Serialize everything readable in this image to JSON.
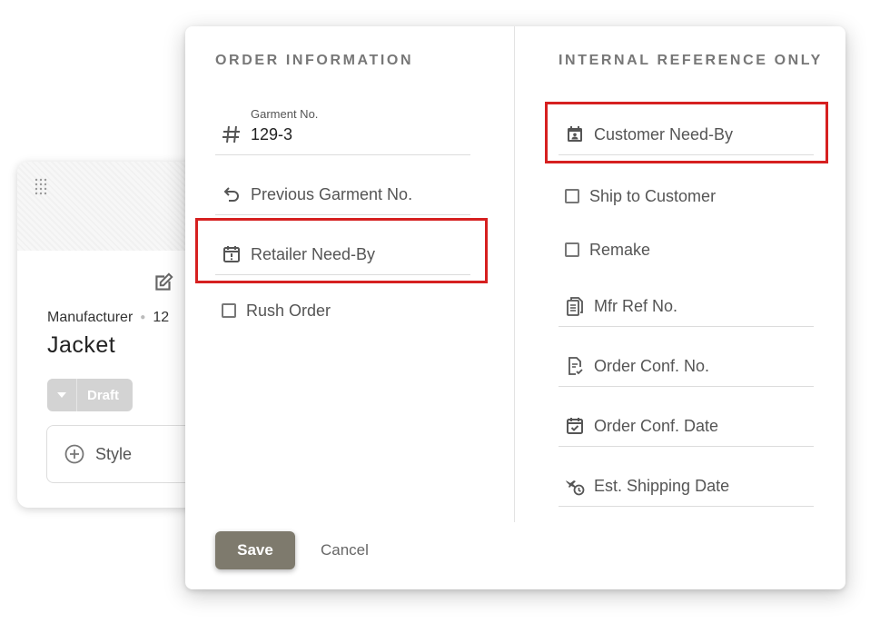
{
  "card": {
    "manufacturer_label": "Manufacturer",
    "manufacturer_value": "12",
    "title": "Jacket",
    "status": "Draft",
    "style_label": "Style"
  },
  "dialog": {
    "left": {
      "section_title": "ORDER INFORMATION",
      "garment_no_label": "Garment No.",
      "garment_no_value": "129-3",
      "previous_garment_label": "Previous Garment No.",
      "retailer_need_by_label": "Retailer Need-By",
      "rush_order_label": "Rush Order"
    },
    "right": {
      "section_title": "INTERNAL REFERENCE ONLY",
      "customer_need_by_label": "Customer Need-By",
      "ship_to_customer_label": "Ship to Customer",
      "remake_label": "Remake",
      "mfr_ref_label": "Mfr Ref No.",
      "order_conf_no_label": "Order Conf. No.",
      "order_conf_date_label": "Order Conf. Date",
      "est_shipping_label": "Est. Shipping Date"
    },
    "save_label": "Save",
    "cancel_label": "Cancel"
  },
  "colors": {
    "highlight": "#d62020",
    "save_button": "#7e7a6d",
    "status_badge": "#d3d3d3"
  }
}
